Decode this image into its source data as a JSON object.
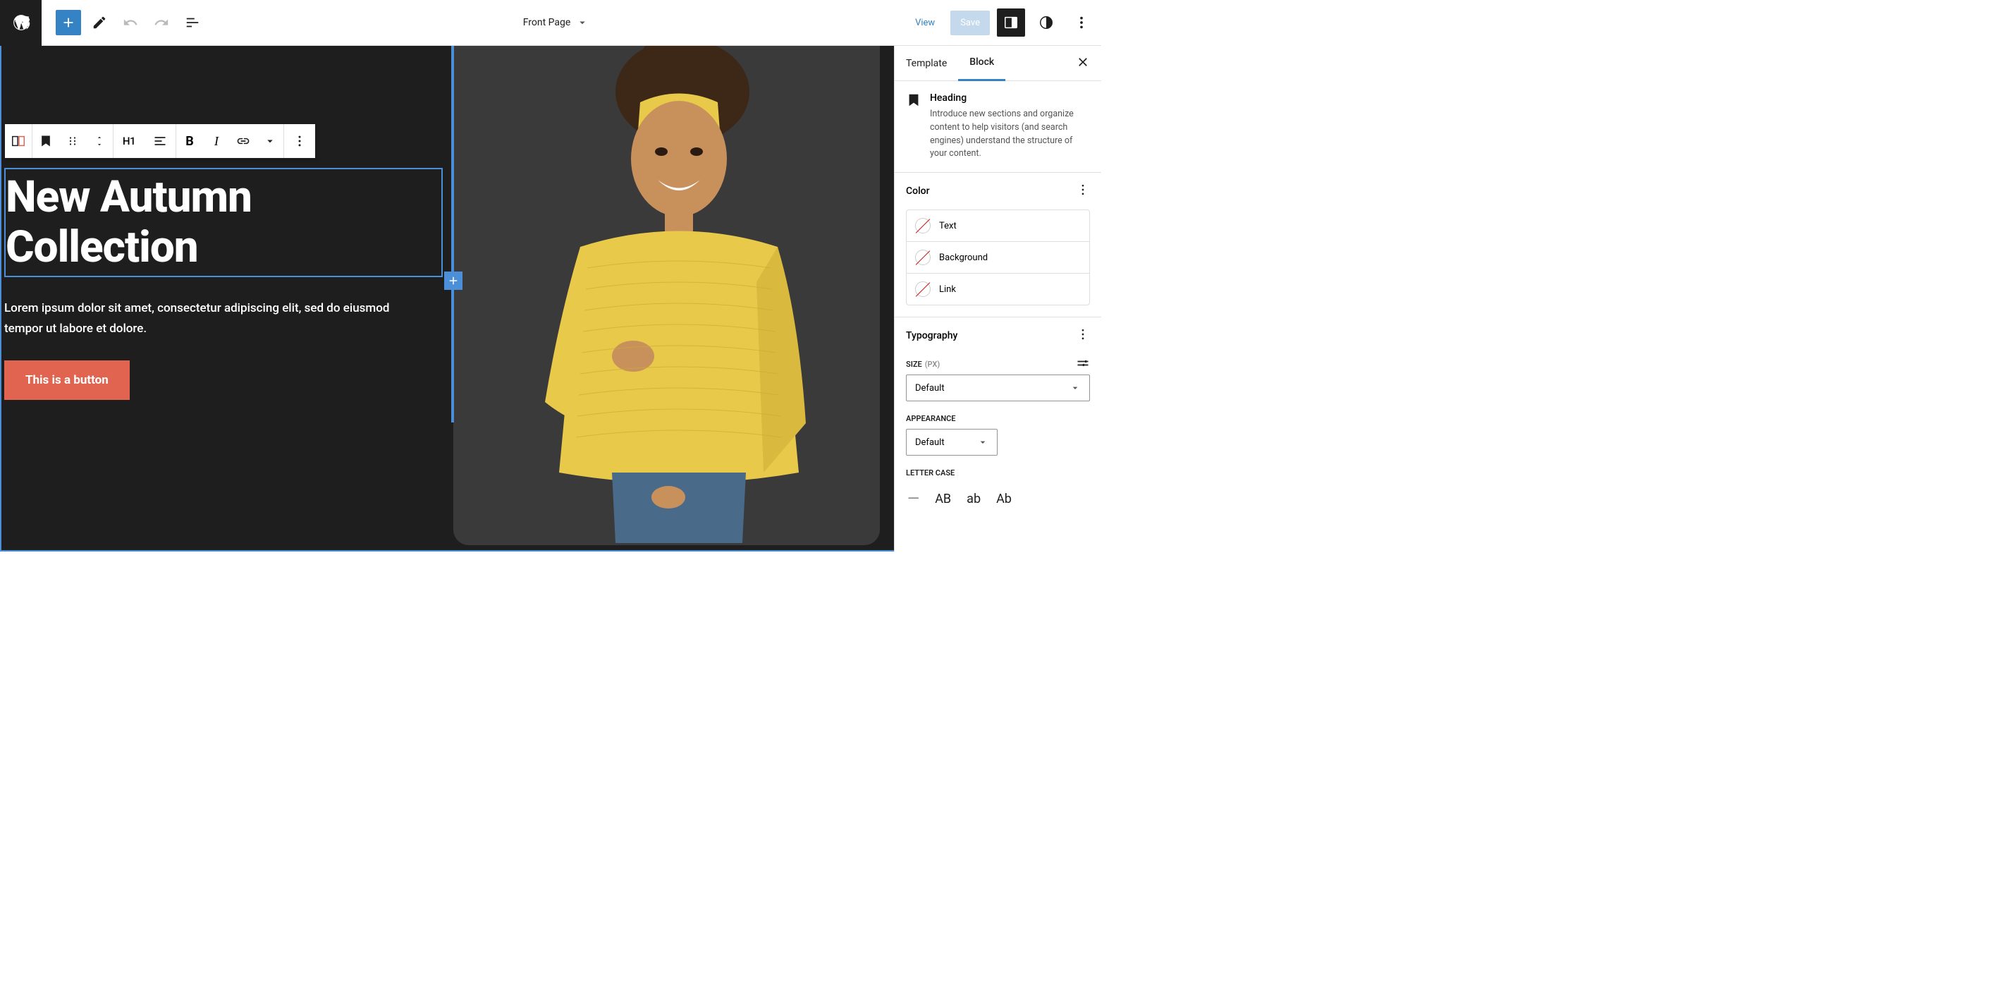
{
  "topbar": {
    "page_title": "Front Page",
    "view": "View",
    "save": "Save"
  },
  "toolbar": {
    "heading_level": "H1"
  },
  "content": {
    "heading": "New Autumn Collection",
    "paragraph": "Lorem ipsum dolor sit amet, consectetur adipiscing elit, sed do eiusmod tempor ut labore et dolore.",
    "button": "This is a button"
  },
  "sidebar": {
    "tabs": {
      "template": "Template",
      "block": "Block"
    },
    "block_info": {
      "name": "Heading",
      "description": "Introduce new sections and organize content to help visitors (and search engines) understand the structure of your content."
    },
    "panels": {
      "color": {
        "title": "Color",
        "items": {
          "text": "Text",
          "background": "Background",
          "link": "Link"
        }
      },
      "typography": {
        "title": "Typography",
        "size_label": "SIZE",
        "size_unit": "(PX)",
        "size_value": "Default",
        "appearance_label": "APPEARANCE",
        "appearance_value": "Default",
        "lettercase_label": "LETTER CASE",
        "lettercase_options": {
          "none": "—",
          "upper": "AB",
          "lower": "ab",
          "cap": "Ab"
        }
      }
    }
  }
}
